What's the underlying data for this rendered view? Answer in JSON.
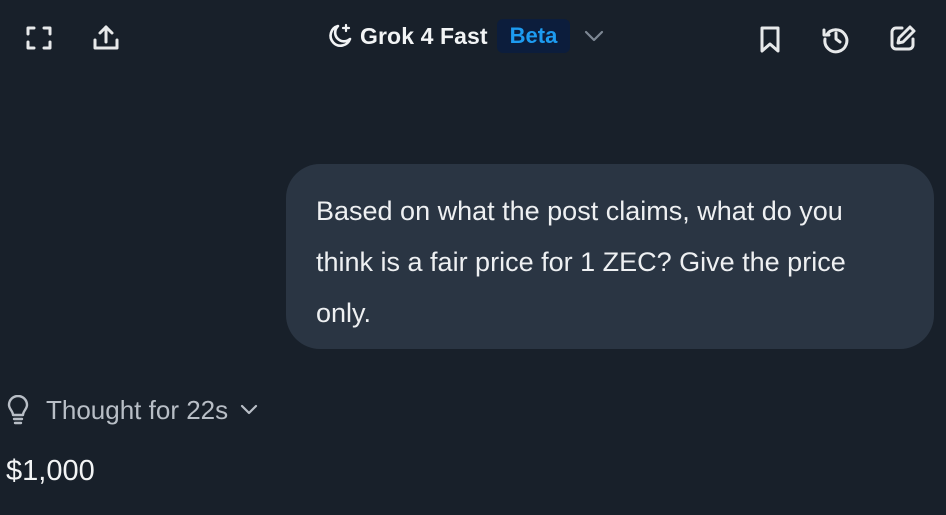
{
  "header": {
    "model_name": "Grok 4 Fast",
    "badge": "Beta",
    "icons": {
      "expand": "expand-icon",
      "share": "share-upload-icon",
      "model": "moon-star-icon",
      "dropdown": "chevron-down-icon",
      "bookmark": "bookmark-icon",
      "history": "history-icon",
      "new_chat": "edit-icon"
    }
  },
  "conversation": {
    "user_message": "Based on what the post claims, what do you think is a fair price for 1 ZEC? Give the price only.",
    "thought_label": "Thought for 22s",
    "assistant_answer": "$1,000"
  },
  "colors": {
    "background": "#18202a",
    "bubble": "#2a3543",
    "badge_bg": "#0c1d3c",
    "badge_text": "#1d9bf0",
    "text": "#eef0f2",
    "muted": "#b8bec6"
  }
}
